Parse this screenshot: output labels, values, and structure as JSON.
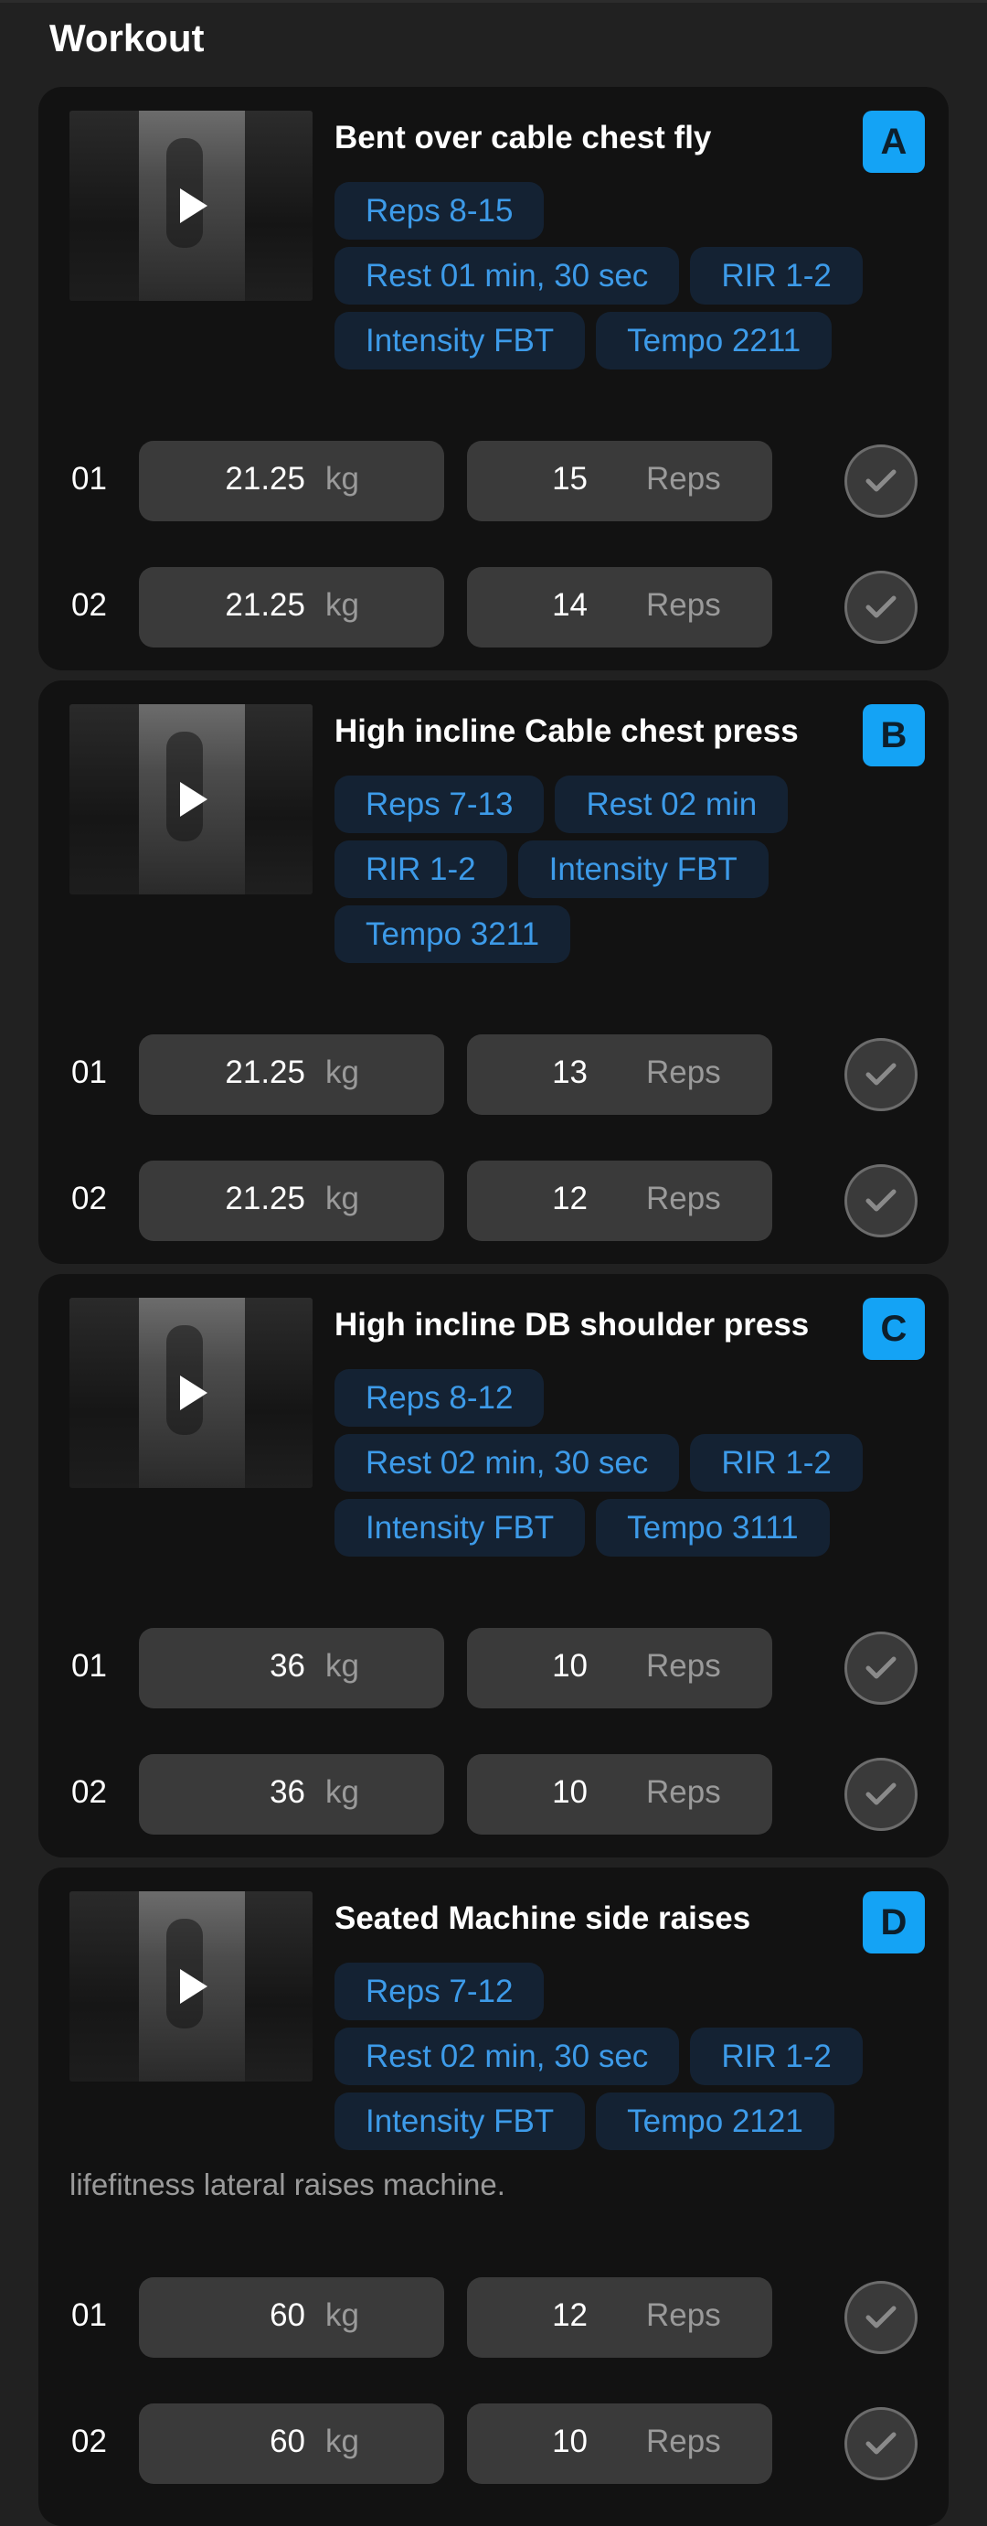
{
  "page": {
    "title": "Workout"
  },
  "exercises": [
    {
      "title": "Bent over cable chest fly",
      "letter": "A",
      "tags": [
        "Reps 8-15",
        "Rest 01 min, 30 sec",
        "RIR 1-2",
        "Intensity FBT",
        "Tempo 2211"
      ],
      "note": "",
      "unit_weight": "kg",
      "unit_reps": "Reps",
      "sets": [
        {
          "num": "01",
          "weight": "21.25",
          "reps": "15"
        },
        {
          "num": "02",
          "weight": "21.25",
          "reps": "14"
        }
      ]
    },
    {
      "title": "High incline Cable chest press",
      "letter": "B",
      "tags": [
        "Reps 7-13",
        "Rest 02 min",
        "RIR 1-2",
        "Intensity FBT",
        "Tempo 3211"
      ],
      "note": "",
      "unit_weight": "kg",
      "unit_reps": "Reps",
      "sets": [
        {
          "num": "01",
          "weight": "21.25",
          "reps": "13"
        },
        {
          "num": "02",
          "weight": "21.25",
          "reps": "12"
        }
      ]
    },
    {
      "title": "High incline DB shoulder press",
      "letter": "C",
      "tags": [
        "Reps 8-12",
        "Rest 02 min, 30 sec",
        "RIR 1-2",
        "Intensity FBT",
        "Tempo 3111"
      ],
      "note": "",
      "unit_weight": "kg",
      "unit_reps": "Reps",
      "sets": [
        {
          "num": "01",
          "weight": "36",
          "reps": "10"
        },
        {
          "num": "02",
          "weight": "36",
          "reps": "10"
        }
      ]
    },
    {
      "title": "Seated Machine side raises",
      "letter": "D",
      "tags": [
        "Reps 7-12",
        "Rest 02 min, 30 sec",
        "RIR 1-2",
        "Intensity FBT",
        "Tempo 2121"
      ],
      "note": "lifefitness lateral raises machine.",
      "unit_weight": "kg",
      "unit_reps": "Reps",
      "sets": [
        {
          "num": "01",
          "weight": "60",
          "reps": "12"
        },
        {
          "num": "02",
          "weight": "60",
          "reps": "10"
        }
      ]
    }
  ],
  "colors": {
    "accent": "#14a3f5",
    "tag_bg": "#142233",
    "tag_text": "#3d9be9",
    "card_bg": "#121212"
  },
  "icons": {
    "play": "play-icon",
    "check": "check-icon"
  }
}
